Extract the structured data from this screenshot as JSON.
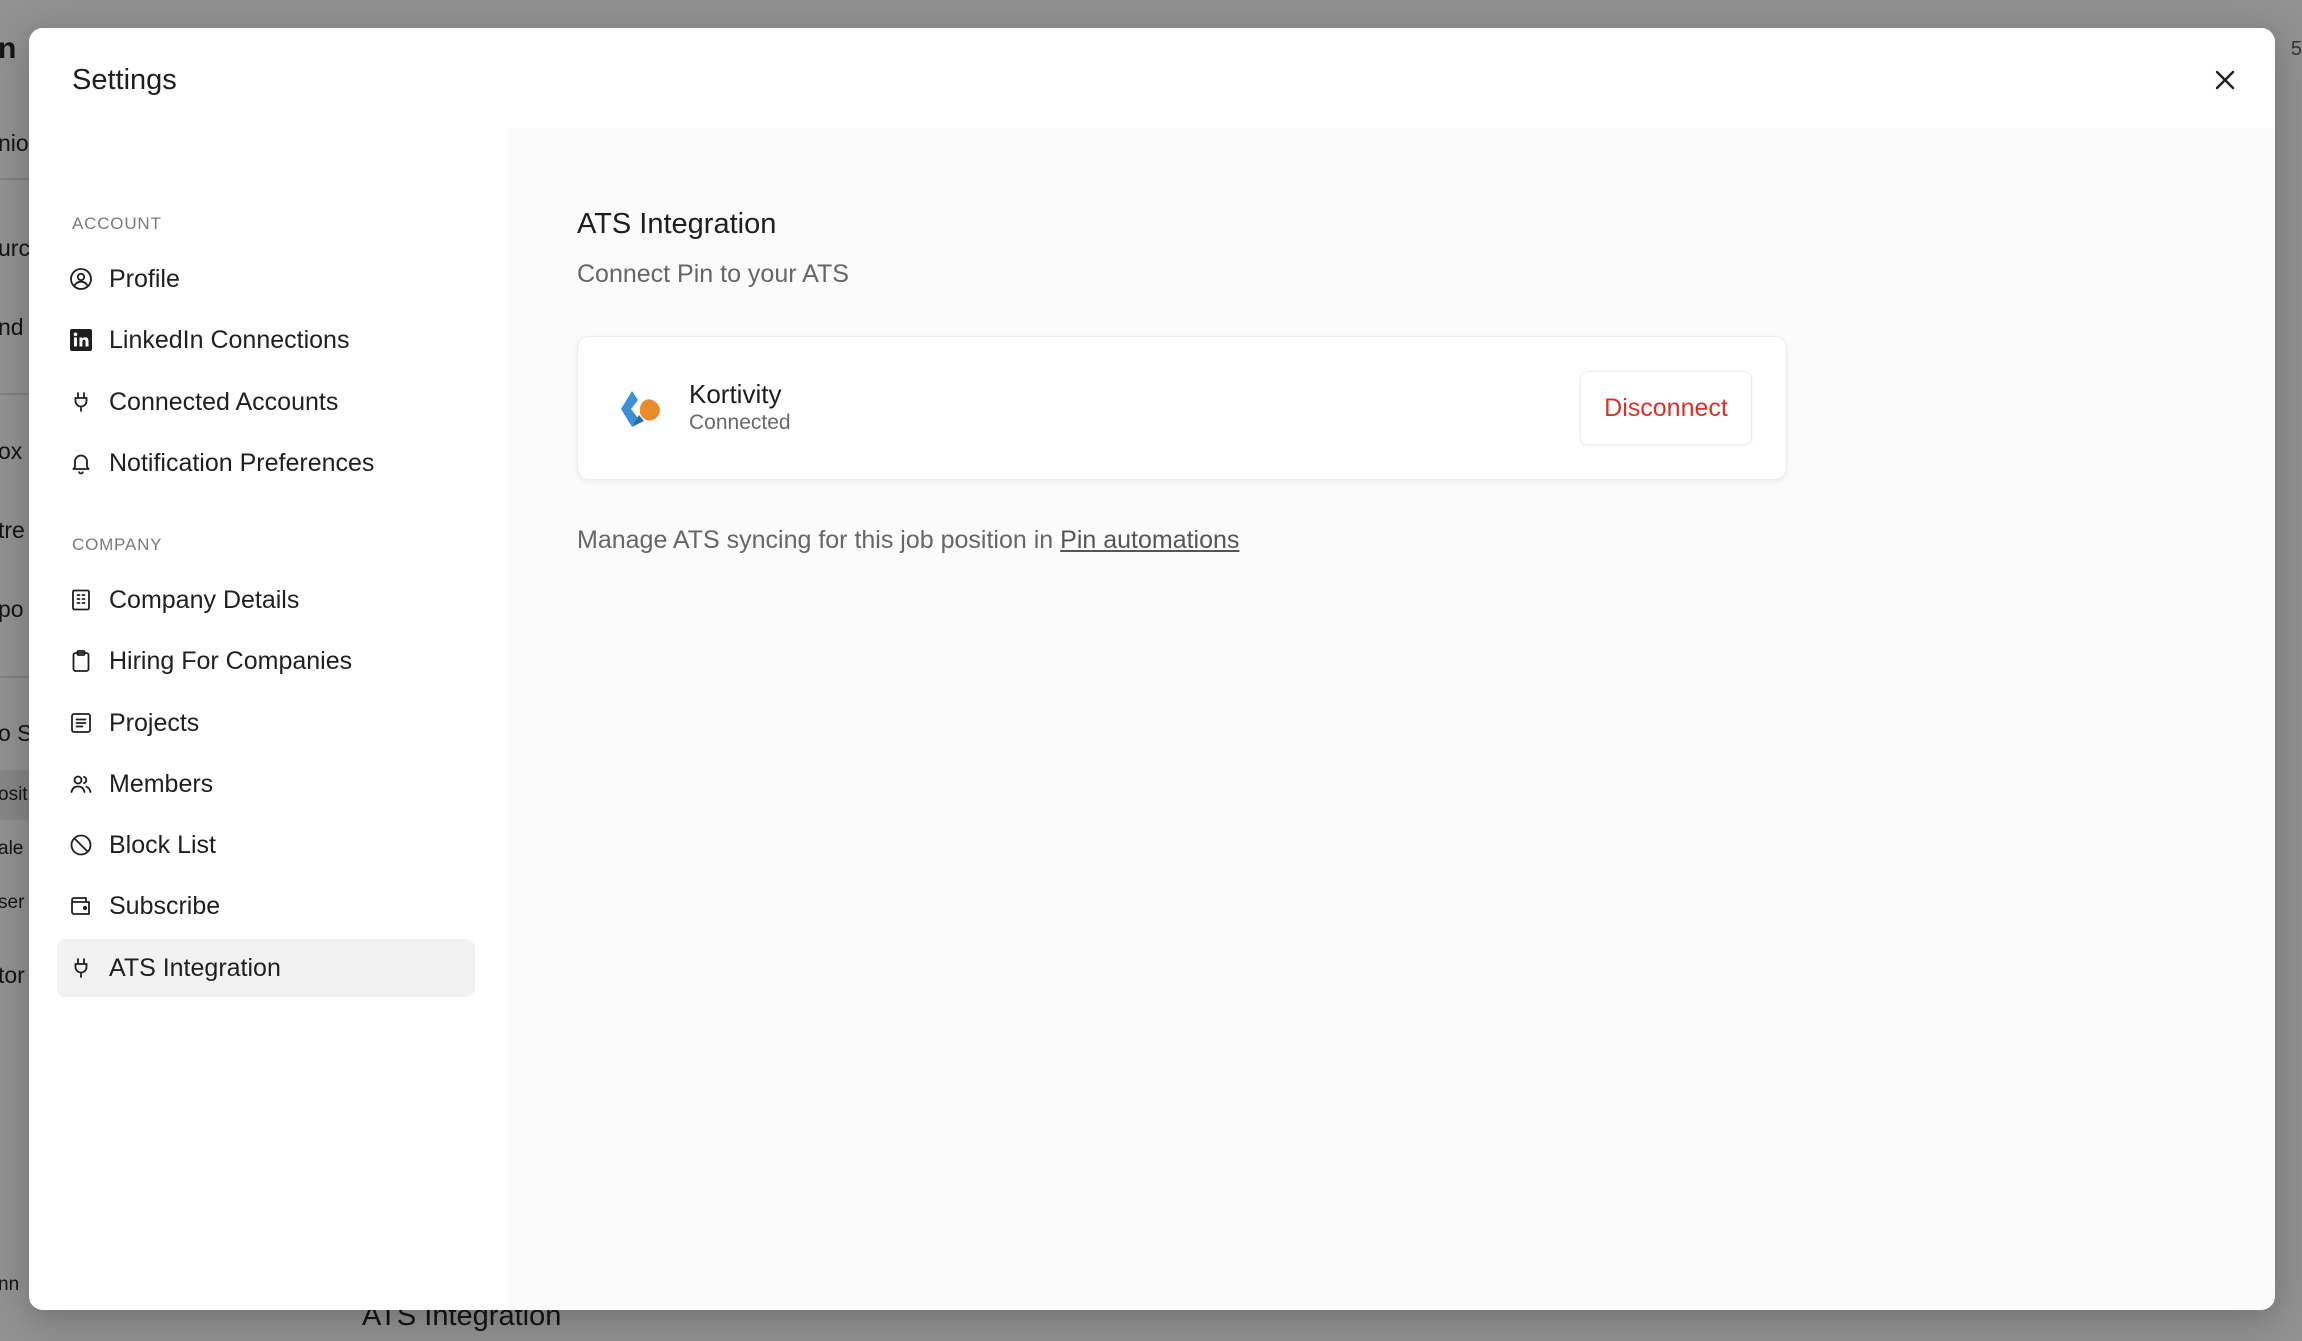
{
  "background": {
    "bottom_title": "ATS Integration",
    "top_right_fragment": "5",
    "left_fragments": [
      "n",
      "nio",
      "urc",
      "nd",
      "ox",
      "tre",
      "po",
      "o S",
      "osit",
      "ale",
      "ser",
      "tor",
      "nn"
    ]
  },
  "modal": {
    "title": "Settings",
    "close_icon": "x-icon"
  },
  "sidebar": {
    "sections": [
      {
        "label": "ACCOUNT",
        "items": [
          {
            "label": "Profile",
            "icon": "user-circle-icon"
          },
          {
            "label": "LinkedIn Connections",
            "icon": "linkedin-icon"
          },
          {
            "label": "Connected Accounts",
            "icon": "plug-icon"
          },
          {
            "label": "Notification Preferences",
            "icon": "bell-icon"
          }
        ]
      },
      {
        "label": "COMPANY",
        "items": [
          {
            "label": "Company Details",
            "icon": "building-icon"
          },
          {
            "label": "Hiring For Companies",
            "icon": "clipboard-icon"
          },
          {
            "label": "Projects",
            "icon": "list-icon"
          },
          {
            "label": "Members",
            "icon": "users-icon"
          },
          {
            "label": "Block List",
            "icon": "ban-icon"
          },
          {
            "label": "Subscribe",
            "icon": "wallet-icon"
          },
          {
            "label": "ATS Integration",
            "icon": "plug-icon",
            "active": true
          }
        ]
      }
    ]
  },
  "content": {
    "title": "ATS Integration",
    "subtitle": "Connect Pin to your ATS",
    "integration": {
      "name": "Kortivity",
      "status": "Connected",
      "action_label": "Disconnect",
      "action_color": "#d0342c"
    },
    "manage_text": "Manage ATS syncing for this job position in",
    "manage_link": "Pin automations"
  },
  "colors": {
    "accent_danger": "#d0342c",
    "logo_orange": "#e98a2c",
    "logo_blue": "#3d8fd1"
  }
}
